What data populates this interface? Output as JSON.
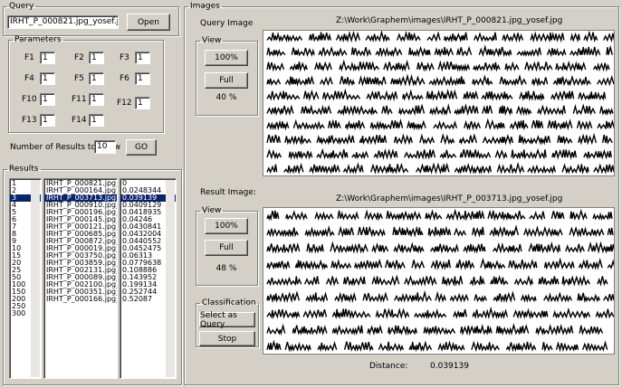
{
  "query": {
    "legend": "Query",
    "filename": "IRHT_P_000821.jpg_yosef.jpg",
    "open_label": "Open"
  },
  "parameters": {
    "legend": "Parameters",
    "fields": [
      {
        "label": "F1",
        "value": "1"
      },
      {
        "label": "F2",
        "value": "1"
      },
      {
        "label": "F3",
        "value": "1"
      },
      {
        "label": "F4",
        "value": "1"
      },
      {
        "label": "F5",
        "value": "1"
      },
      {
        "label": "F6",
        "value": "1"
      },
      {
        "label": "F10",
        "value": "1"
      },
      {
        "label": "F11",
        "value": "1"
      },
      {
        "label": "F12",
        "value": "1"
      },
      {
        "label": "F13",
        "value": "1"
      },
      {
        "label": "F14",
        "value": "1"
      }
    ],
    "num_results_label": "Number of Results to Show",
    "num_results_value": "10",
    "go_label": "GO"
  },
  "results": {
    "legend": "Results",
    "ranks": [
      "1",
      "2",
      "3",
      "4",
      "5",
      "6",
      "7",
      "8",
      "9",
      "10",
      "15",
      "20",
      "25",
      "50",
      "100",
      "150",
      "200",
      "250",
      "300"
    ],
    "files": [
      "IRHT_P_000821.jpg_y",
      "IRHT_P_000164.jpg_y",
      "IRHT_P_003713.jpg_y",
      "IRHT_P_000910.jpg_y",
      "IRHT_P_000196.jpg_y",
      "IRHT_P_000145.jpg_y",
      "IRHT_P_000121.jpg_y",
      "IRHT_P_000685.jpg_y",
      "IRHT_P_000872.jpg_y",
      "IRHT_P_000019.jpg_y",
      "IRHT_P_003750.jpg_y",
      "IRHT_P_003859.jpg_y",
      "IRHT_P_002131.jpg_y",
      "IRHT_P_000089.jpg_y",
      "IRHT_P_002100.jpg_y",
      "IRHT_P_000351.jpg_y",
      "IRHT_P_000166.jpg_y"
    ],
    "distances": [
      "0",
      "0.0248344",
      "0.039139",
      "0.0409129",
      "0.0418935",
      "0.04246",
      "0.0430841",
      "0.0432004",
      "0.0440552",
      "0.0452475",
      "0.06313",
      "0.0779638",
      "0.108886",
      "0.143952",
      "0.199134",
      "0.252744",
      "0.52087"
    ],
    "selected_index": 2
  },
  "images": {
    "legend": "Images",
    "query_label": "Query Image",
    "query_path": "Z:\\Work\\Graphem\\images\\IRHT_P_000821.jpg_yosef.jpg",
    "result_label": "Result Image:",
    "result_path": "Z:\\Work\\Graphem\\images\\IRHT_P_003713.jpg_yosef.jpg",
    "query_view": {
      "legend": "View",
      "btn100": "100%",
      "full": "Full",
      "zoom": "40 %"
    },
    "result_view": {
      "legend": "View",
      "btn100": "100%",
      "full": "Full",
      "zoom": "48 %"
    },
    "classification": {
      "legend": "Classification",
      "select_label": "Select as Query",
      "stop_label": "Stop"
    },
    "distance_label": "Distance:",
    "distance_value": "0.039139"
  }
}
